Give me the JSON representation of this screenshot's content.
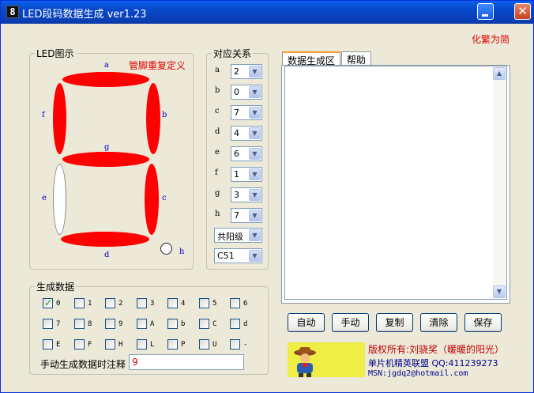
{
  "window": {
    "title": "LED段码数据生成 ver1.23",
    "app_icon_glyph": "8",
    "minimize_glyph": "_",
    "close_glyph": "✕"
  },
  "top_link": "化繁为简",
  "led_group": {
    "title": "LED图示",
    "redefine_link": "管脚重复定义",
    "segments": [
      {
        "id": "a",
        "on": true
      },
      {
        "id": "b",
        "on": true
      },
      {
        "id": "c",
        "on": true
      },
      {
        "id": "d",
        "on": true
      },
      {
        "id": "e",
        "on": false
      },
      {
        "id": "f",
        "on": true
      },
      {
        "id": "g",
        "on": true
      },
      {
        "id": "h",
        "on": false
      }
    ]
  },
  "mapping_group": {
    "title": "对应关系",
    "rows": [
      {
        "seg": "a",
        "value": "2"
      },
      {
        "seg": "b",
        "value": "0"
      },
      {
        "seg": "c",
        "value": "7"
      },
      {
        "seg": "d",
        "value": "4"
      },
      {
        "seg": "e",
        "value": "6"
      },
      {
        "seg": "f",
        "value": "1"
      },
      {
        "seg": "g",
        "value": "3"
      },
      {
        "seg": "h",
        "value": "7"
      }
    ],
    "polarity": "共阳级",
    "format": "C51",
    "dropdown_glyph": "▼"
  },
  "tabs": [
    {
      "label": "数据生成区",
      "active": true
    },
    {
      "label": "帮助",
      "active": false
    }
  ],
  "output_text": "",
  "scroll": {
    "up": "▲",
    "down": "▼"
  },
  "buttons": {
    "auto": "自动",
    "manual": "手动",
    "copy": "复制",
    "clear": "清除",
    "save": "保存"
  },
  "gen_group": {
    "title": "生成数据",
    "checkboxes": [
      {
        "glyph": "0",
        "checked": true
      },
      {
        "glyph": "1",
        "checked": false
      },
      {
        "glyph": "2",
        "checked": false
      },
      {
        "glyph": "3",
        "checked": false
      },
      {
        "glyph": "4",
        "checked": false
      },
      {
        "glyph": "5",
        "checked": false
      },
      {
        "glyph": "6",
        "checked": false
      },
      {
        "glyph": "7",
        "checked": false
      },
      {
        "glyph": "8",
        "checked": false
      },
      {
        "glyph": "9",
        "checked": false
      },
      {
        "glyph": "A",
        "checked": false
      },
      {
        "glyph": "b",
        "checked": false
      },
      {
        "glyph": "C",
        "checked": false
      },
      {
        "glyph": "d",
        "checked": false
      },
      {
        "glyph": "E",
        "checked": false
      },
      {
        "glyph": "F",
        "checked": false
      },
      {
        "glyph": "H",
        "checked": false
      },
      {
        "glyph": "L",
        "checked": false
      },
      {
        "glyph": "P",
        "checked": false
      },
      {
        "glyph": "U",
        "checked": false
      },
      {
        "glyph": "-",
        "checked": false
      }
    ],
    "check_glyph": "✓",
    "note_label": "手动生成数据时注释",
    "note_value": "9"
  },
  "credits": {
    "line1": "版权所有:刘骁奖（暖暖的阳光）",
    "line2": "单片机精英联盟 QQ:411239273",
    "line3": "MSN:jgdq2@hotmail.com"
  },
  "colors": {
    "segment_on": "#ff0000",
    "accent_text": "#e00000",
    "label_blue": "#0000cc"
  }
}
